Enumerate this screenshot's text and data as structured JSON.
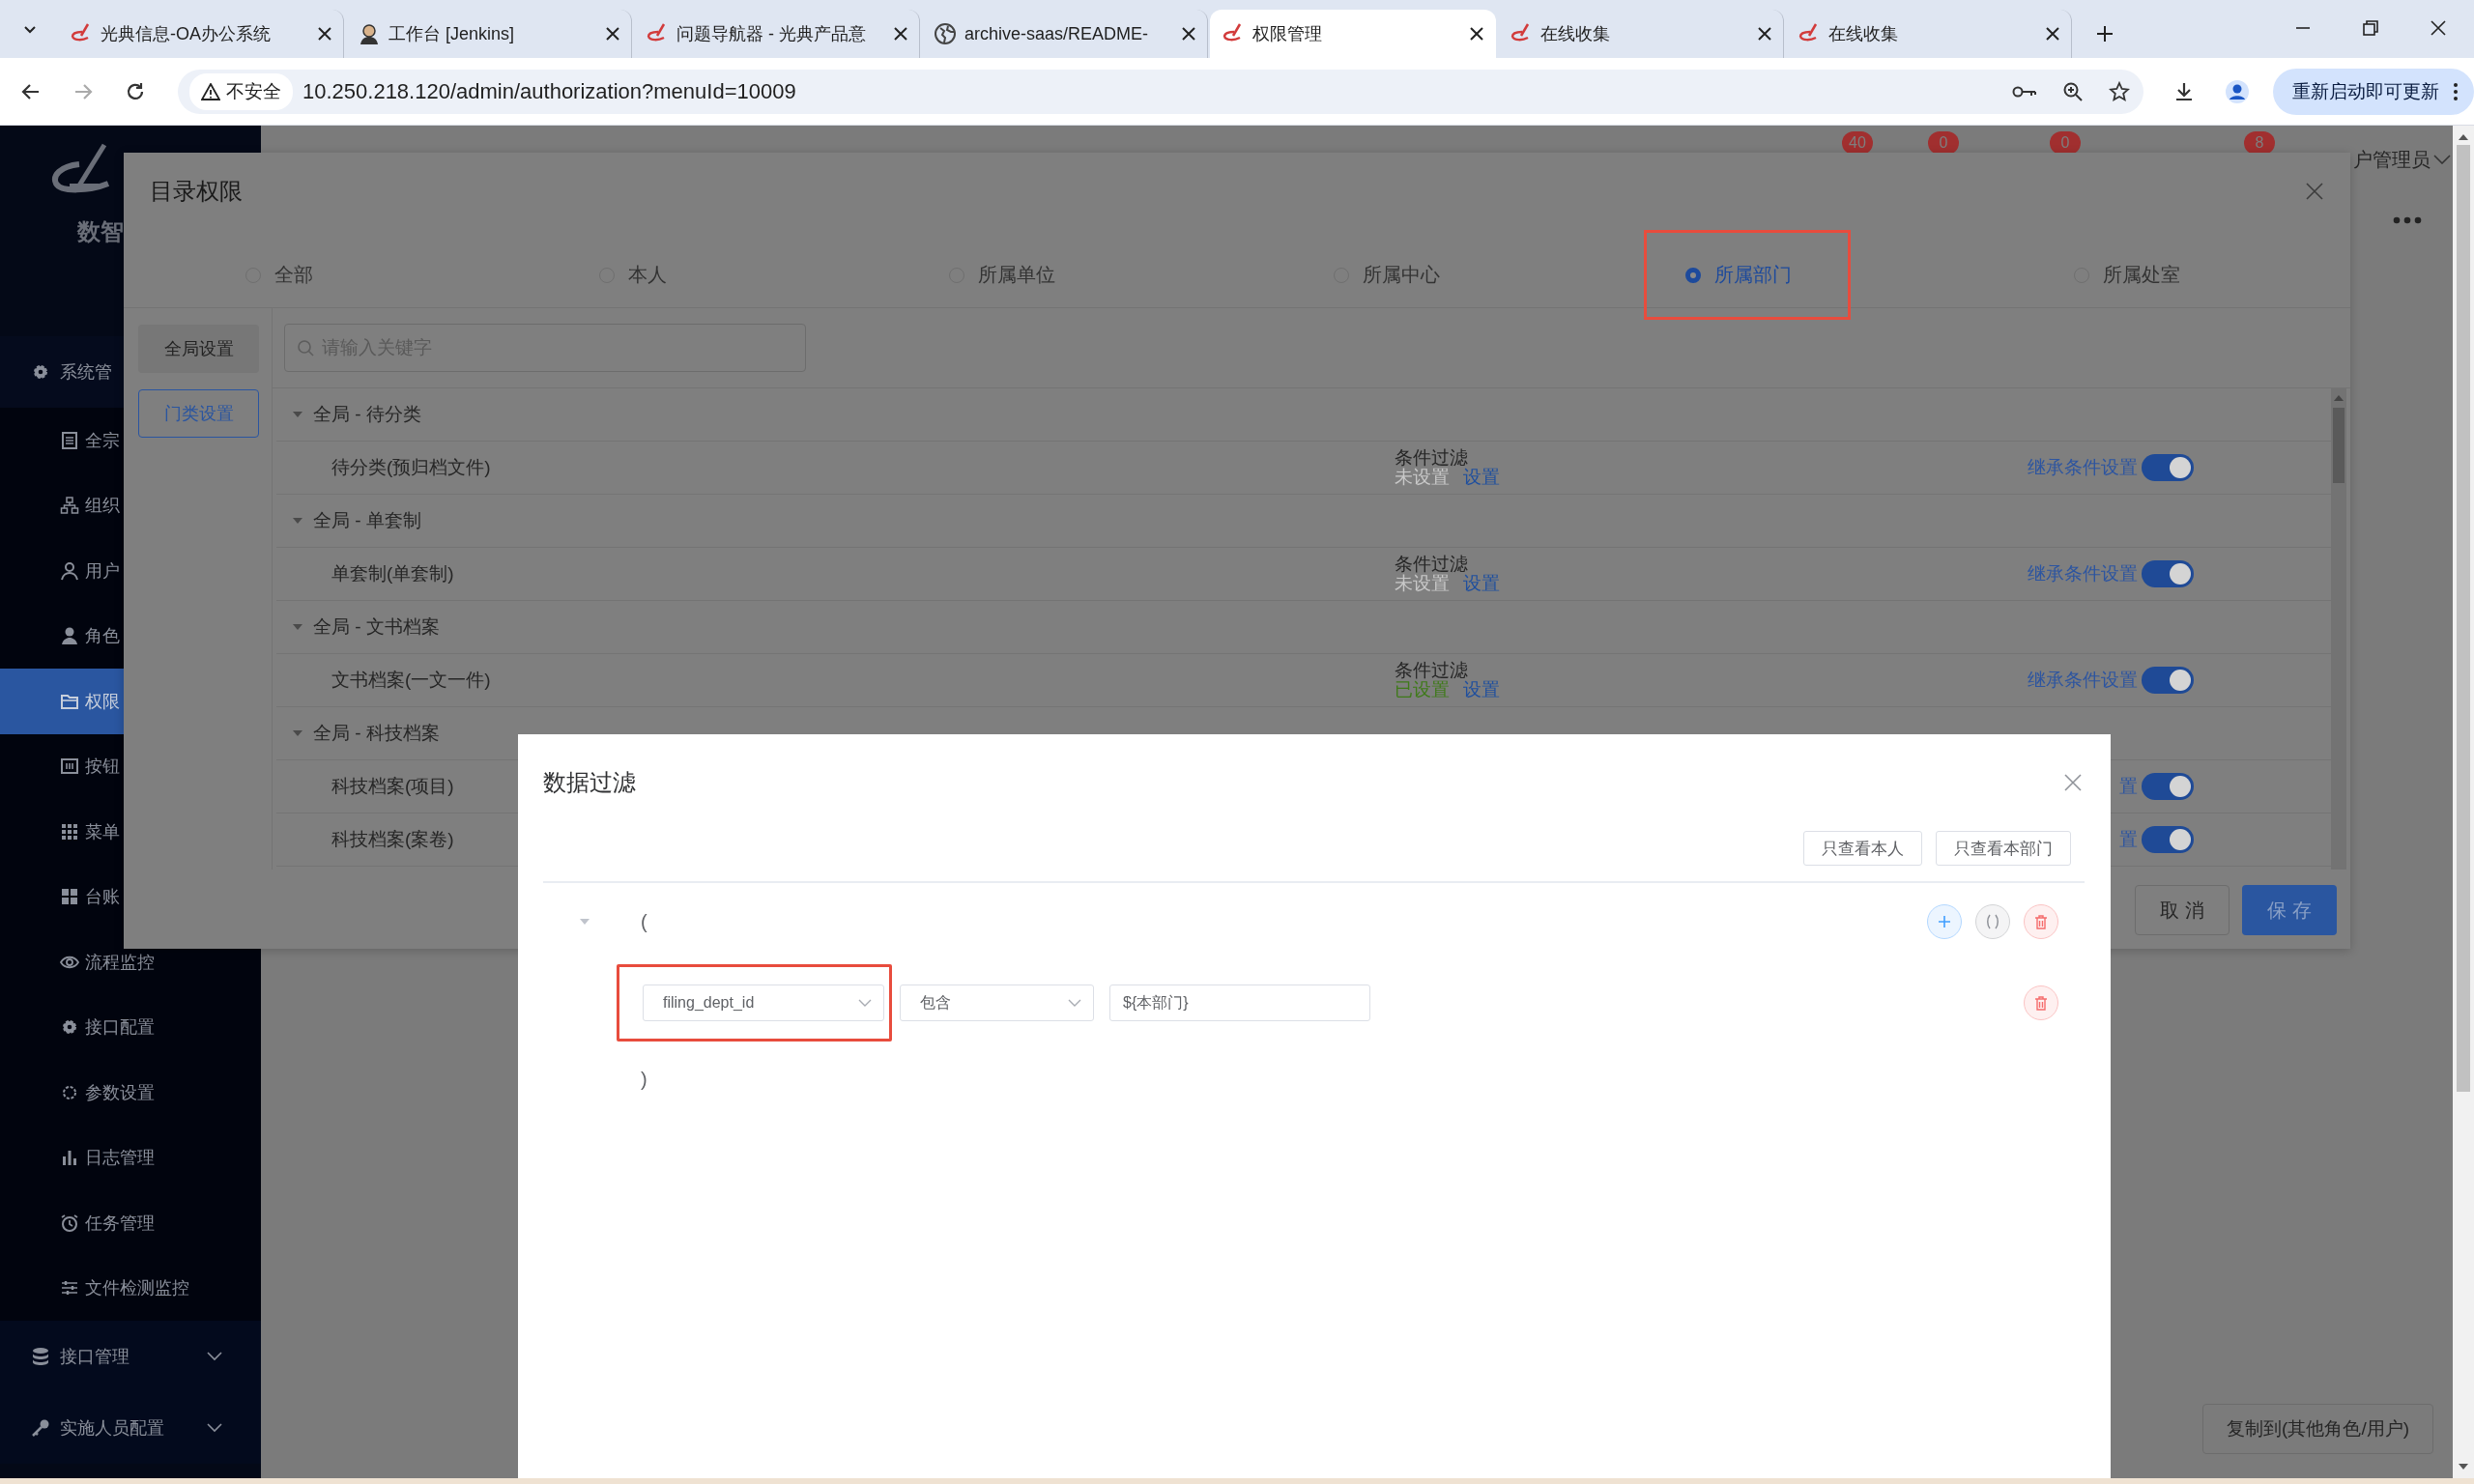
{
  "browser": {
    "tabs": [
      {
        "title": "光典信息-OA办公系统",
        "selected": false
      },
      {
        "title": "工作台 [Jenkins]",
        "selected": false
      },
      {
        "title": "问题导航器 - 光典产品意",
        "selected": false
      },
      {
        "title": "archive-saas/README-",
        "selected": false
      },
      {
        "title": "权限管理",
        "selected": true
      },
      {
        "title": "在线收集",
        "selected": false
      },
      {
        "title": "在线收集",
        "selected": false
      }
    ],
    "security": "不安全",
    "url": "10.250.218.120/admin/authorization?menuId=10009",
    "update_button": "重新启动即可更新"
  },
  "sidebar": {
    "brand": "数智",
    "items": [
      {
        "label": "系统管",
        "kind": "group",
        "selected": false
      },
      {
        "label": "全宗",
        "kind": "item",
        "selected": false
      },
      {
        "label": "组织",
        "kind": "item",
        "selected": false
      },
      {
        "label": "用户",
        "kind": "item",
        "selected": false
      },
      {
        "label": "角色",
        "kind": "item",
        "selected": false
      },
      {
        "label": "权限",
        "kind": "item",
        "selected": true
      },
      {
        "label": "按钮",
        "kind": "item",
        "selected": false
      },
      {
        "label": "菜单",
        "kind": "item",
        "selected": false
      },
      {
        "label": "台账",
        "kind": "item",
        "selected": false
      },
      {
        "label": "流程监控",
        "kind": "item",
        "selected": false
      },
      {
        "label": "接口配置",
        "kind": "item",
        "selected": false
      },
      {
        "label": "参数设置",
        "kind": "item",
        "selected": false
      },
      {
        "label": "日志管理",
        "kind": "item",
        "selected": false
      },
      {
        "label": "任务管理",
        "kind": "item",
        "selected": false
      },
      {
        "label": "文件检测监控",
        "kind": "item",
        "selected": false
      },
      {
        "label": "接口管理",
        "kind": "group",
        "selected": false,
        "expanded": false
      },
      {
        "label": "实施人员配置",
        "kind": "group",
        "selected": false,
        "expanded": false
      }
    ]
  },
  "header": {
    "badges": [
      "40",
      "0",
      "0",
      "8"
    ],
    "user": "户管理员"
  },
  "copy_button": "复制到(其他角色/用户)",
  "permission_dialog": {
    "title": "目录权限",
    "scopes": [
      {
        "label": "全部",
        "selected": false,
        "highlighted": false
      },
      {
        "label": "本人",
        "selected": false,
        "highlighted": false
      },
      {
        "label": "所属单位",
        "selected": false,
        "highlighted": false
      },
      {
        "label": "所属中心",
        "selected": false,
        "highlighted": false
      },
      {
        "label": "所属部门",
        "selected": true,
        "highlighted": true
      },
      {
        "label": "所属处室",
        "selected": false,
        "highlighted": false
      }
    ],
    "side_tabs": [
      {
        "label": "全局设置",
        "selected": false
      },
      {
        "label": "门类设置",
        "selected": true
      }
    ],
    "search": {
      "placeholder": "请输入关键字"
    },
    "tree": [
      {
        "label": "全局 - 待分类",
        "expanded": true,
        "children": [
          {
            "label": "待分类(预归档文件)",
            "filter_label": "条件过滤",
            "filter_status": "未设置",
            "filter_set": false,
            "filter_link": "设置",
            "inherit_label": "继承条件设置",
            "inherit_on": true
          }
        ]
      },
      {
        "label": "全局 - 单套制",
        "expanded": true,
        "children": [
          {
            "label": "单套制(单套制)",
            "filter_label": "条件过滤",
            "filter_status": "未设置",
            "filter_set": false,
            "filter_link": "设置",
            "inherit_label": "继承条件设置",
            "inherit_on": true
          }
        ]
      },
      {
        "label": "全局 - 文书档案",
        "expanded": true,
        "children": [
          {
            "label": "文书档案(一文一件)",
            "filter_label": "条件过滤",
            "filter_status": "已设置",
            "filter_set": true,
            "filter_link": "设置",
            "inherit_label": "继承条件设置",
            "inherit_on": true
          }
        ]
      },
      {
        "label": "全局 - 科技档案",
        "expanded": true,
        "children": [
          {
            "label": "科技档案(项目)",
            "inherit_label": "置",
            "inherit_on": true
          },
          {
            "label": "科技档案(案卷)",
            "inherit_label": "置",
            "inherit_on": true
          }
        ]
      }
    ],
    "cancel": "取 消",
    "save": "保 存"
  },
  "filter_dialog": {
    "title": "数据过滤",
    "quick_buttons": [
      "只查看本人",
      "只查看本部门"
    ],
    "group": {
      "expanded": true,
      "open": "(",
      "close": ")",
      "conditions": [
        {
          "field": "filing_dept_id",
          "operator": "包含",
          "value": "${本部门}",
          "highlighted": true
        }
      ]
    }
  }
}
